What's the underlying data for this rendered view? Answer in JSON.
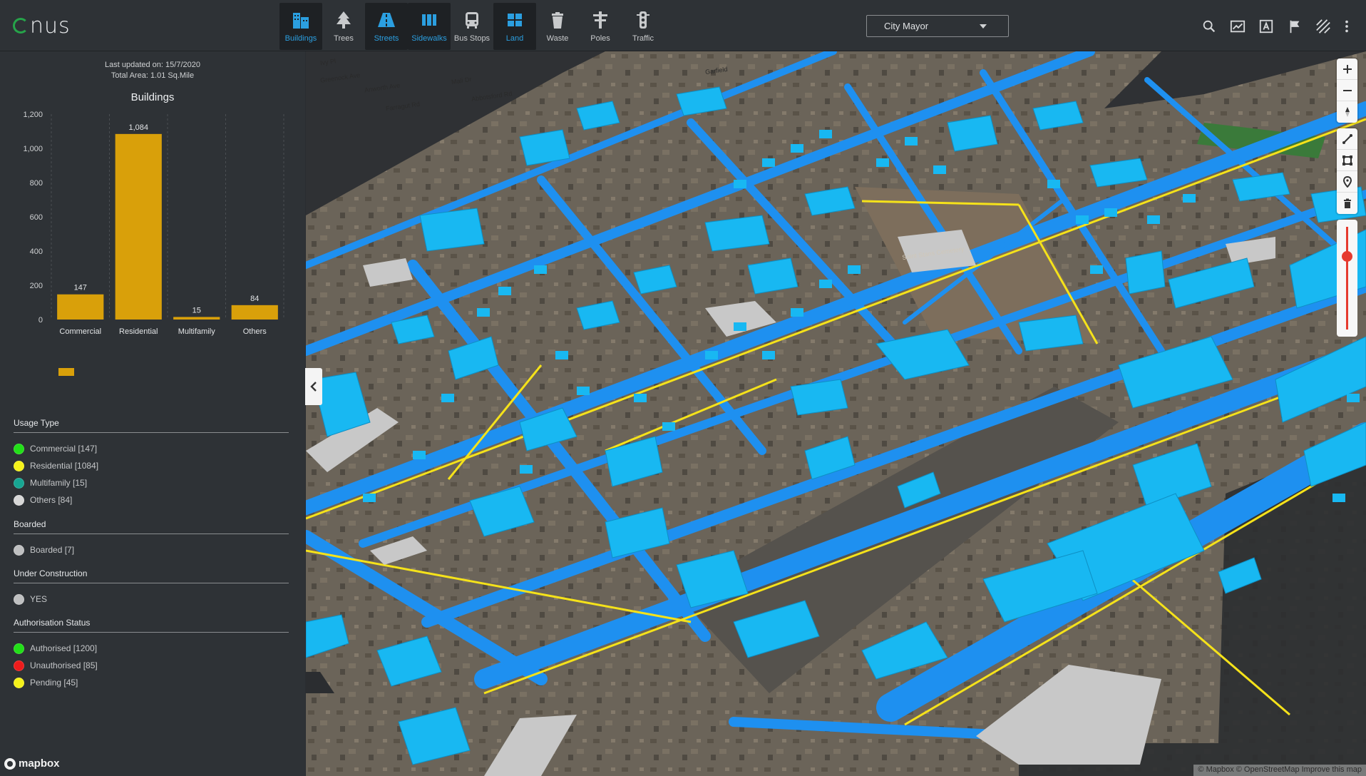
{
  "app": {
    "logo_text": "nus"
  },
  "layers": [
    {
      "id": "buildings",
      "label": "Buildings",
      "active": true
    },
    {
      "id": "trees",
      "label": "Trees",
      "active": false
    },
    {
      "id": "streets",
      "label": "Streets",
      "active": true
    },
    {
      "id": "sidewalks",
      "label": "Sidewalks",
      "active": true
    },
    {
      "id": "busstops",
      "label": "Bus Stops",
      "active": false
    },
    {
      "id": "land",
      "label": "Land",
      "active": true
    },
    {
      "id": "waste",
      "label": "Waste",
      "active": false
    },
    {
      "id": "poles",
      "label": "Poles",
      "active": false
    },
    {
      "id": "traffic",
      "label": "Traffic",
      "active": false
    }
  ],
  "role_select": {
    "value": "City Mayor"
  },
  "top_tools": [
    "search-icon",
    "chart-icon",
    "text-select-icon",
    "flag-icon",
    "hatch-icon",
    "more-vert-icon"
  ],
  "panel": {
    "last_updated": "Last updated on: 15/7/2020",
    "total_area": "Total Area: 1.01 Sq.Mile",
    "chart_title": "Buildings",
    "collapse_icon": "chevron-left-icon"
  },
  "chart_data": {
    "type": "bar",
    "title": "Buildings",
    "categories": [
      "Commercial",
      "Residential",
      "Multifamily",
      "Others"
    ],
    "values": [
      147,
      1084,
      15,
      84
    ],
    "value_labels": [
      "147",
      "1,084",
      "15",
      "84"
    ],
    "yticks": [
      "0",
      "200",
      "400",
      "600",
      "800",
      "1,000",
      "1,200"
    ],
    "ylim": [
      0,
      1200
    ],
    "color": "#d9a00a",
    "grid": "vertical dashed"
  },
  "legend": {
    "usage_title": "Usage Type",
    "usage": [
      {
        "label": "Commercial [147]",
        "color": "#22e018"
      },
      {
        "label": "Residential [1084]",
        "color": "#f5f21a"
      },
      {
        "label": "Multifamily [15]",
        "color": "#17a592"
      },
      {
        "label": "Others [84]",
        "color": "#d7d7d7"
      }
    ],
    "boarded_title": "Boarded",
    "boarded": [
      {
        "label": "Boarded [7]",
        "color": "#bfc0c1"
      }
    ],
    "construction_title": "Under Construction",
    "construction": [
      {
        "label": "YES",
        "color": "#bfc0c1"
      }
    ],
    "auth_title": "Authorisation Status",
    "auth": [
      {
        "label": "Authorised [1200]",
        "color": "#22e018"
      },
      {
        "label": "Unauthorised [85]",
        "color": "#ee1c1c"
      },
      {
        "label": "Pending [45]",
        "color": "#f5f21a"
      }
    ]
  },
  "map": {
    "street_labels": [
      "Ivy Pl",
      "Greenock Ave",
      "Anworth Ave",
      "Farragut Rd",
      "Mali Dr",
      "Abbotsford Rd",
      "Garfield",
      "Saint Stans Cemetery"
    ],
    "attribution": "© Mapbox © OpenStreetMap  Improve this map",
    "mapbox_logo": "mapbox",
    "controls": [
      "zoom-in-icon",
      "zoom-out-icon",
      "compass-icon",
      "draw-line-icon",
      "draw-polygon-icon",
      "marker-icon",
      "trash-icon"
    ]
  }
}
